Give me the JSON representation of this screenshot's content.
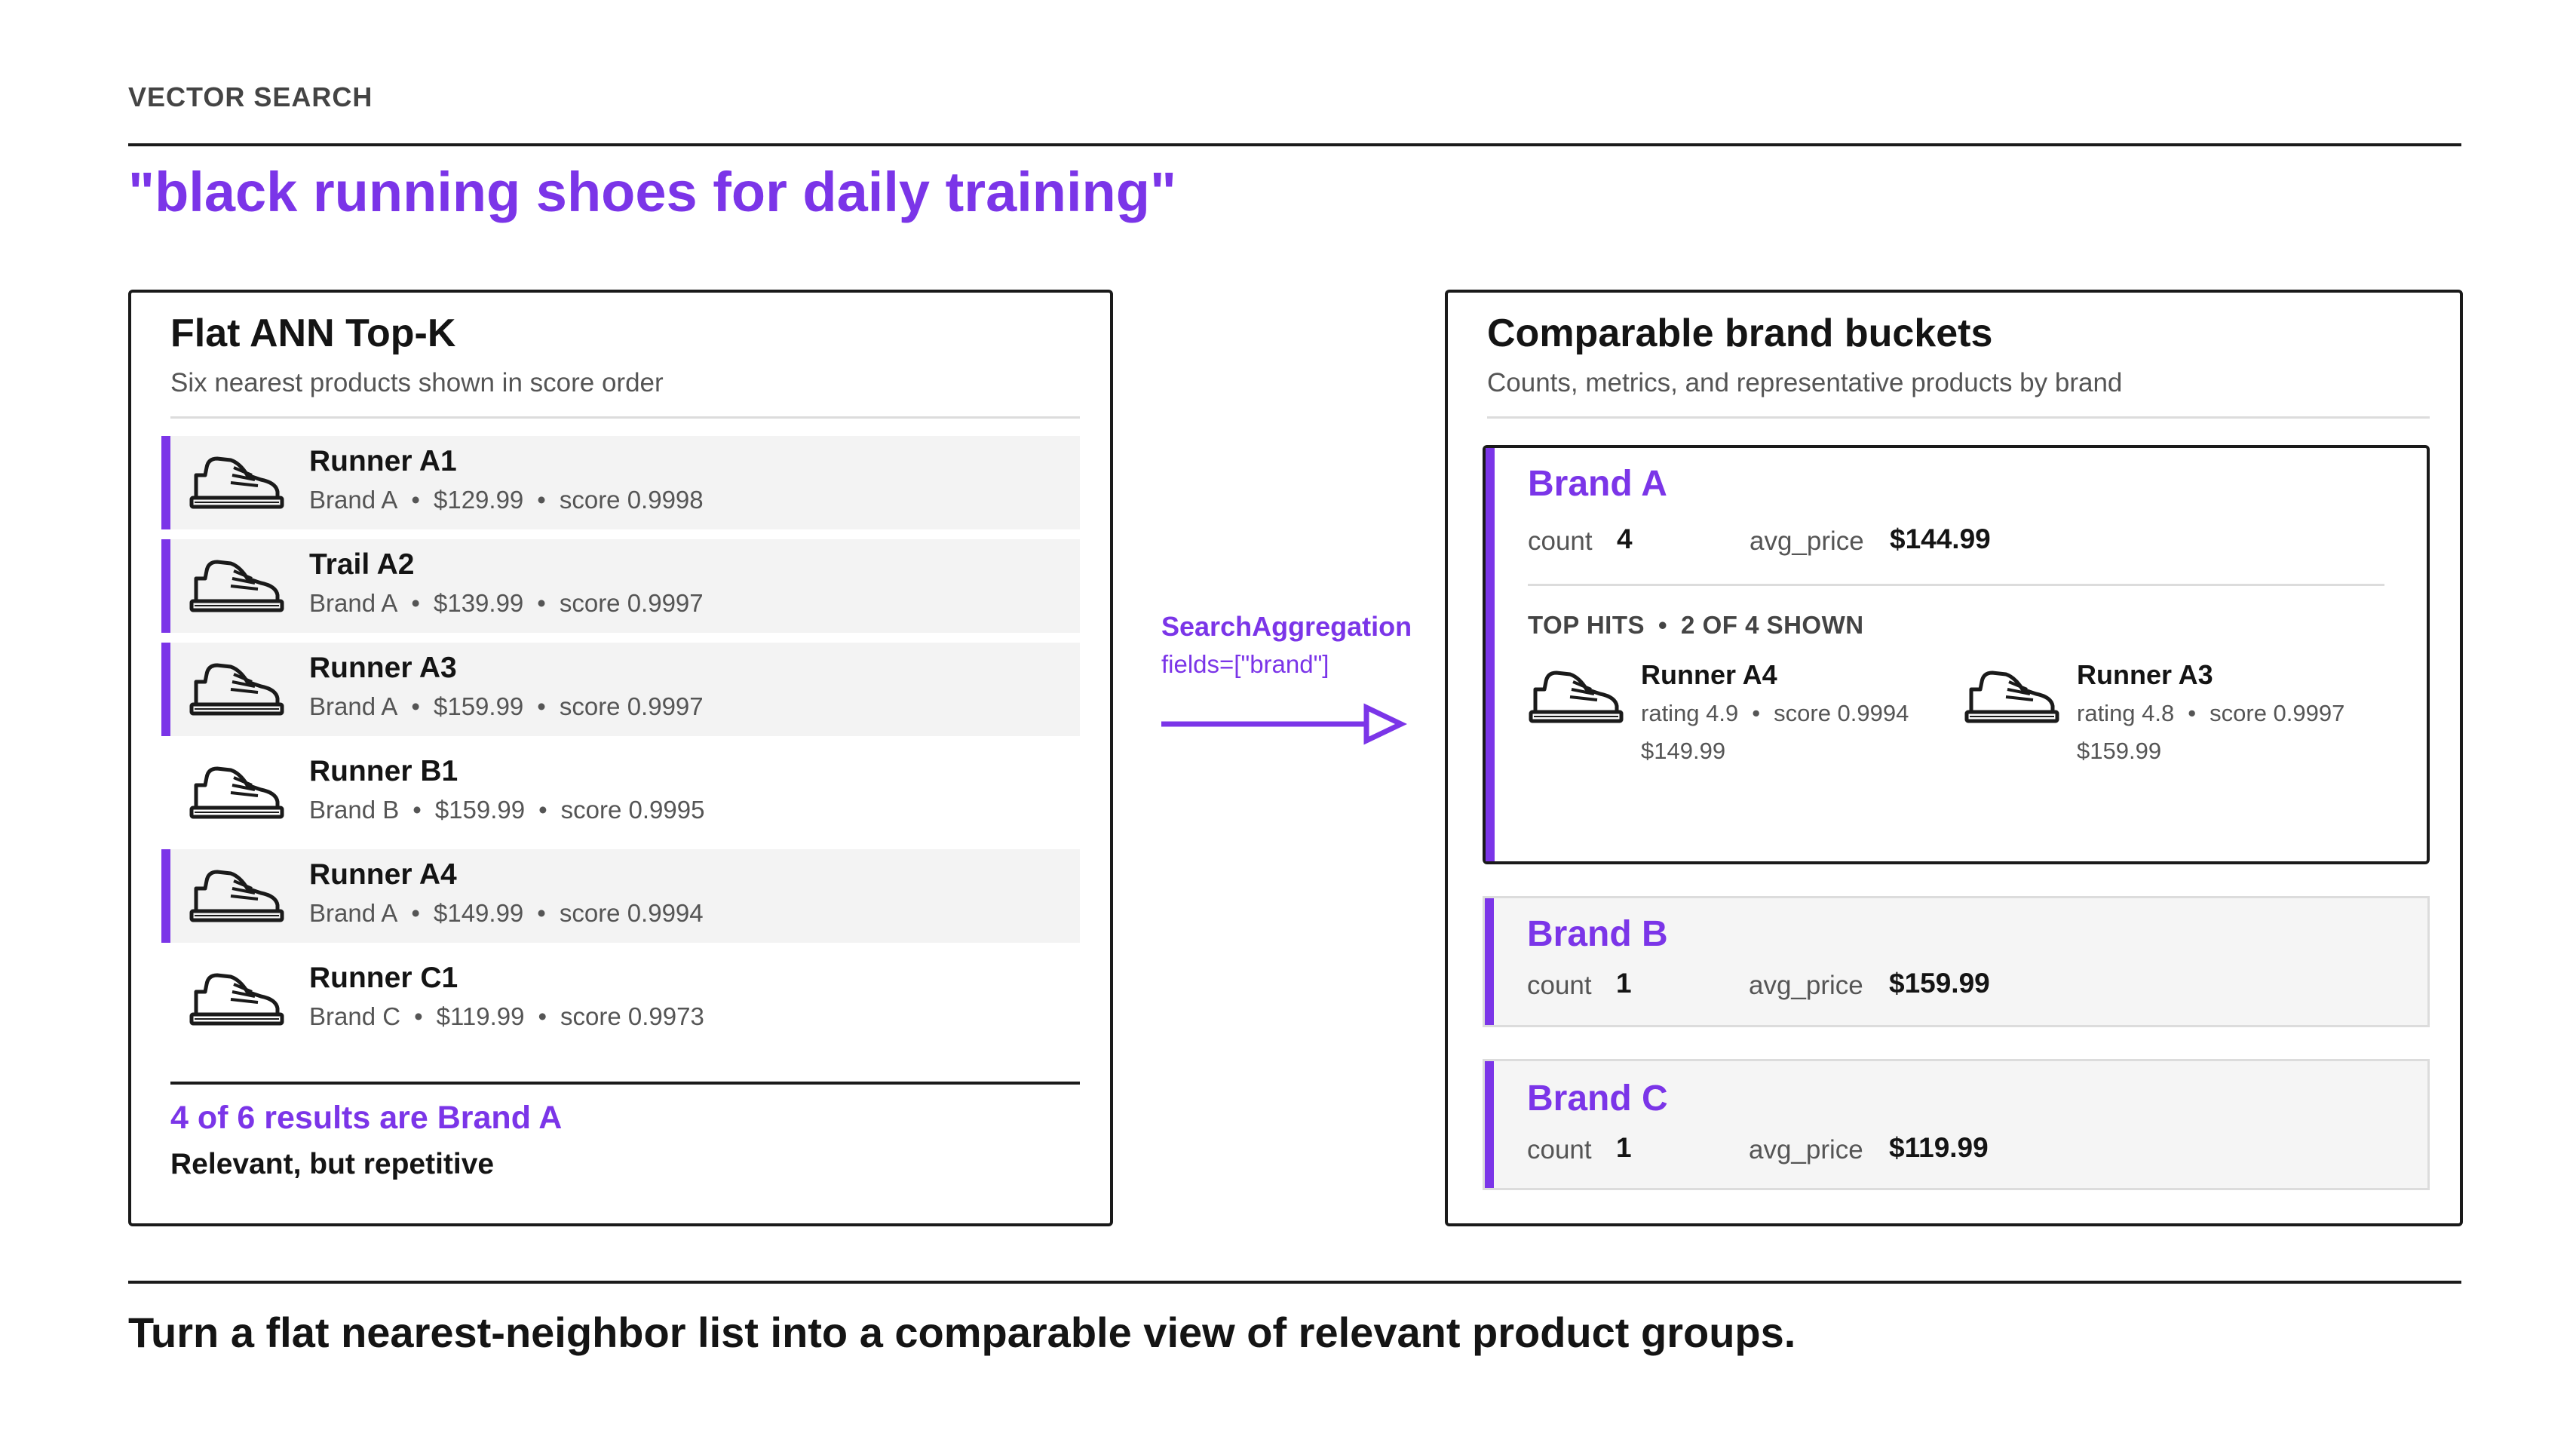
{
  "header": {
    "kicker": "VECTOR SEARCH",
    "query": "\"black running shoes for daily training\""
  },
  "flat_panel": {
    "title": "Flat ANN Top-K",
    "subtitle": "Six nearest products shown in score order",
    "items": [
      {
        "name": "Runner A1",
        "brand": "Brand A",
        "price": "$129.99",
        "score": "score 0.9998",
        "highlighted": true
      },
      {
        "name": "Trail A2",
        "brand": "Brand A",
        "price": "$139.99",
        "score": "score 0.9997",
        "highlighted": true
      },
      {
        "name": "Runner A3",
        "brand": "Brand A",
        "price": "$159.99",
        "score": "score 0.9997",
        "highlighted": true
      },
      {
        "name": "Runner B1",
        "brand": "Brand B",
        "price": "$159.99",
        "score": "score 0.9995",
        "highlighted": false
      },
      {
        "name": "Runner A4",
        "brand": "Brand A",
        "price": "$149.99",
        "score": "score 0.9994",
        "highlighted": true
      },
      {
        "name": "Runner C1",
        "brand": "Brand C",
        "price": "$119.99",
        "score": "score 0.9973",
        "highlighted": false
      }
    ],
    "summary_primary": "4 of 6 results are Brand A",
    "summary_secondary": "Relevant, but repetitive"
  },
  "aggregation": {
    "label": "SearchAggregation",
    "fields": "fields=[\"brand\"]"
  },
  "bucket_panel": {
    "title": "Comparable brand buckets",
    "subtitle": "Counts, metrics, and representative products by brand",
    "count_label": "count",
    "avg_label": "avg_price",
    "buckets": [
      {
        "name": "Brand A",
        "count": "4",
        "avg_price": "$144.99",
        "top_hits_label": "TOP HITS",
        "top_hits_shown": "2 OF 4 SHOWN",
        "hits": [
          {
            "name": "Runner A4",
            "rating": "rating 4.9",
            "score": "score 0.9994",
            "price": "$149.99"
          },
          {
            "name": "Runner A3",
            "rating": "rating 4.8",
            "score": "score 0.9997",
            "price": "$159.99"
          }
        ]
      },
      {
        "name": "Brand B",
        "count": "1",
        "avg_price": "$159.99"
      },
      {
        "name": "Brand C",
        "count": "1",
        "avg_price": "$119.99"
      }
    ]
  },
  "footer": {
    "takeaway": "Turn a flat nearest-neighbor list into a comparable view of relevant product groups."
  },
  "colors": {
    "accent": "#7b35e8",
    "ink": "#141414",
    "muted": "#555555",
    "row_highlight": "#f3f3f3",
    "bucket_fill": "#f5f5f5"
  },
  "icons": {
    "product": "shoe-icon",
    "arrow": "arrow-right-icon"
  }
}
